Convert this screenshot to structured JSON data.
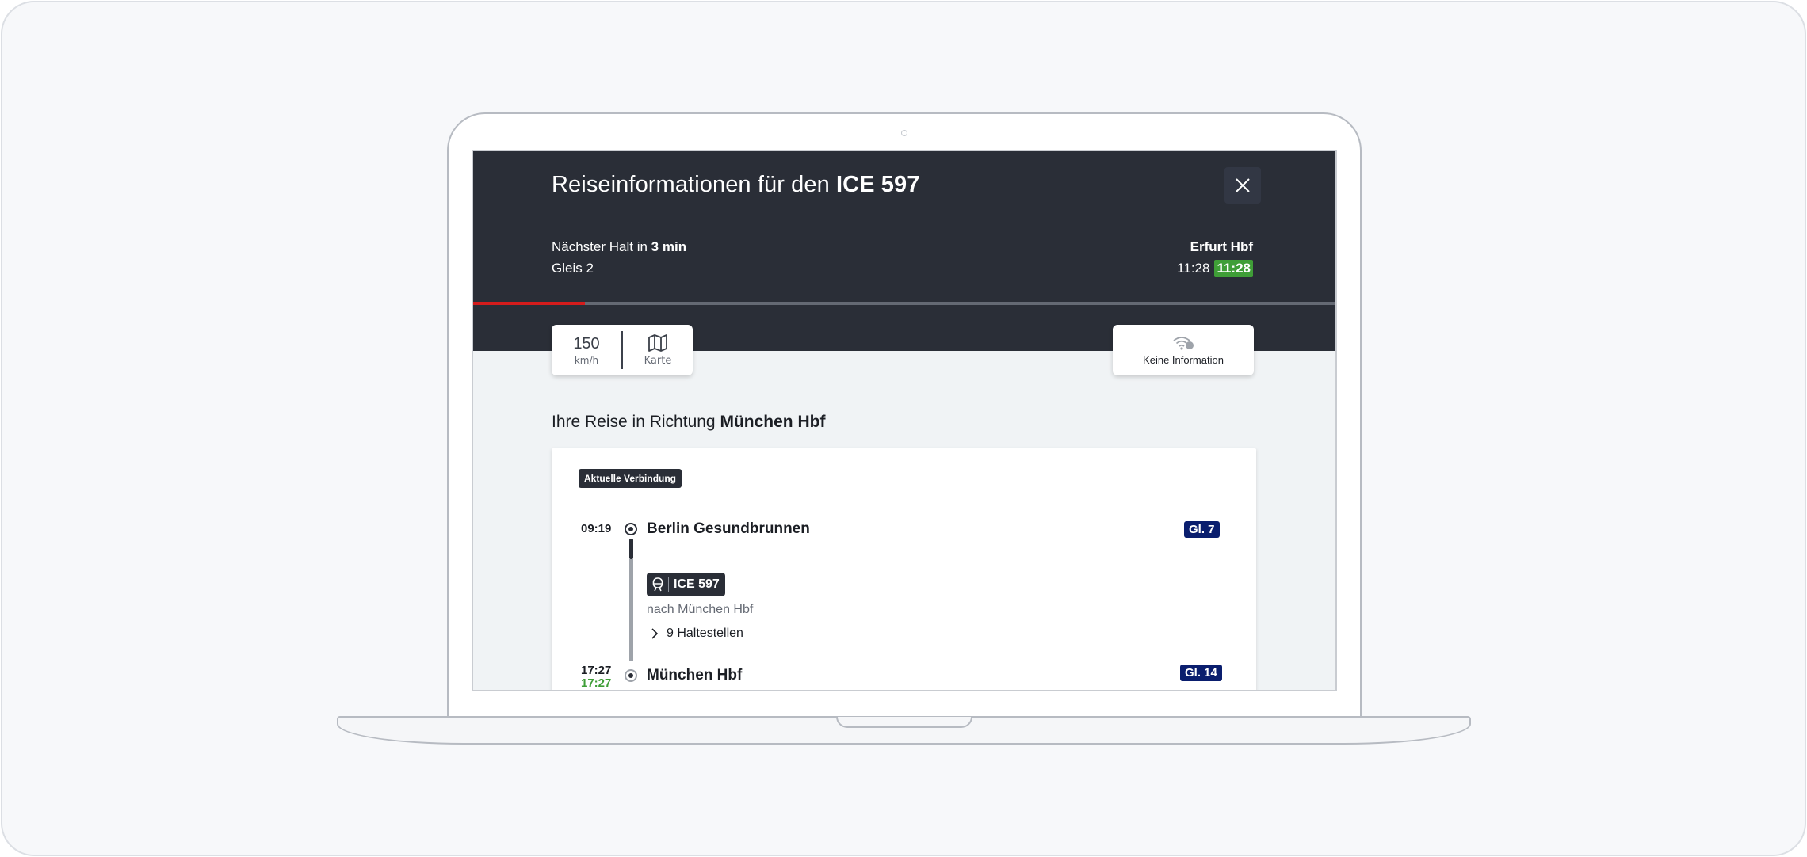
{
  "header": {
    "title_prefix": "Reiseinformationen für den",
    "title_train": "ICE 597",
    "next_stop_prefix": "Nächster Halt in",
    "next_stop_time": "3 min",
    "platform": "Gleis 2",
    "next_station": "Erfurt Hbf",
    "scheduled_time": "11:28",
    "realtime_time": "11:28",
    "progress": 0.13
  },
  "speed": {
    "value": "150",
    "unit": "km/h"
  },
  "map": {
    "label": "Karte"
  },
  "wifi": {
    "label": "Keine Information"
  },
  "journey": {
    "heading_prefix": "Ihre Reise in Richtung",
    "destination": "München Hbf",
    "tag": "Aktuelle Verbindung",
    "departure": {
      "time": "09:19",
      "station": "Berlin Gesundbrunnen",
      "platform": "Gl. 7"
    },
    "train": {
      "name": "ICE 597",
      "direction": "nach München Hbf",
      "stops_label": "9 Haltestellen"
    },
    "arrival": {
      "time": "17:27",
      "realtime": "17:27",
      "station": "München Hbf",
      "platform": "Gl. 14"
    }
  },
  "colors": {
    "header_bg": "#2a2e37",
    "progress": "#d41c1c",
    "realtime": "#3f9e37",
    "platform_badge": "#0a1e6e"
  }
}
